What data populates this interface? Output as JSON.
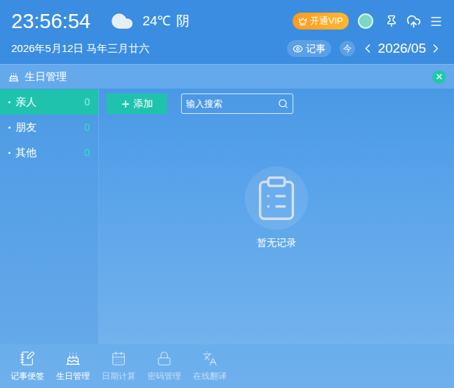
{
  "header": {
    "time": "23:56:54",
    "temperature": "24℃",
    "weather": "阴",
    "vip": "开通VIP",
    "date": "2026年5月12日",
    "lunar": "马年三月廿六",
    "note_button": "记事",
    "today_button": "今",
    "month": "2026/05"
  },
  "panel": {
    "title": "生日管理"
  },
  "sidebar": {
    "items": [
      {
        "label": "亲人",
        "count": "0",
        "selected": true
      },
      {
        "label": "朋友",
        "count": "0",
        "selected": false
      },
      {
        "label": "其他",
        "count": "0",
        "selected": false
      }
    ]
  },
  "toolbar": {
    "add_button": "添加",
    "search_placeholder": "输入搜索"
  },
  "empty_state": {
    "text": "暂无记录"
  },
  "bottom_nav": [
    {
      "label": "记事便签",
      "selected": false,
      "disabled": false
    },
    {
      "label": "生日管理",
      "selected": true,
      "disabled": false
    },
    {
      "label": "日期计算",
      "selected": false,
      "disabled": true
    },
    {
      "label": "密码管理",
      "selected": false,
      "disabled": true
    },
    {
      "label": "在线翻译",
      "selected": false,
      "disabled": true
    }
  ]
}
